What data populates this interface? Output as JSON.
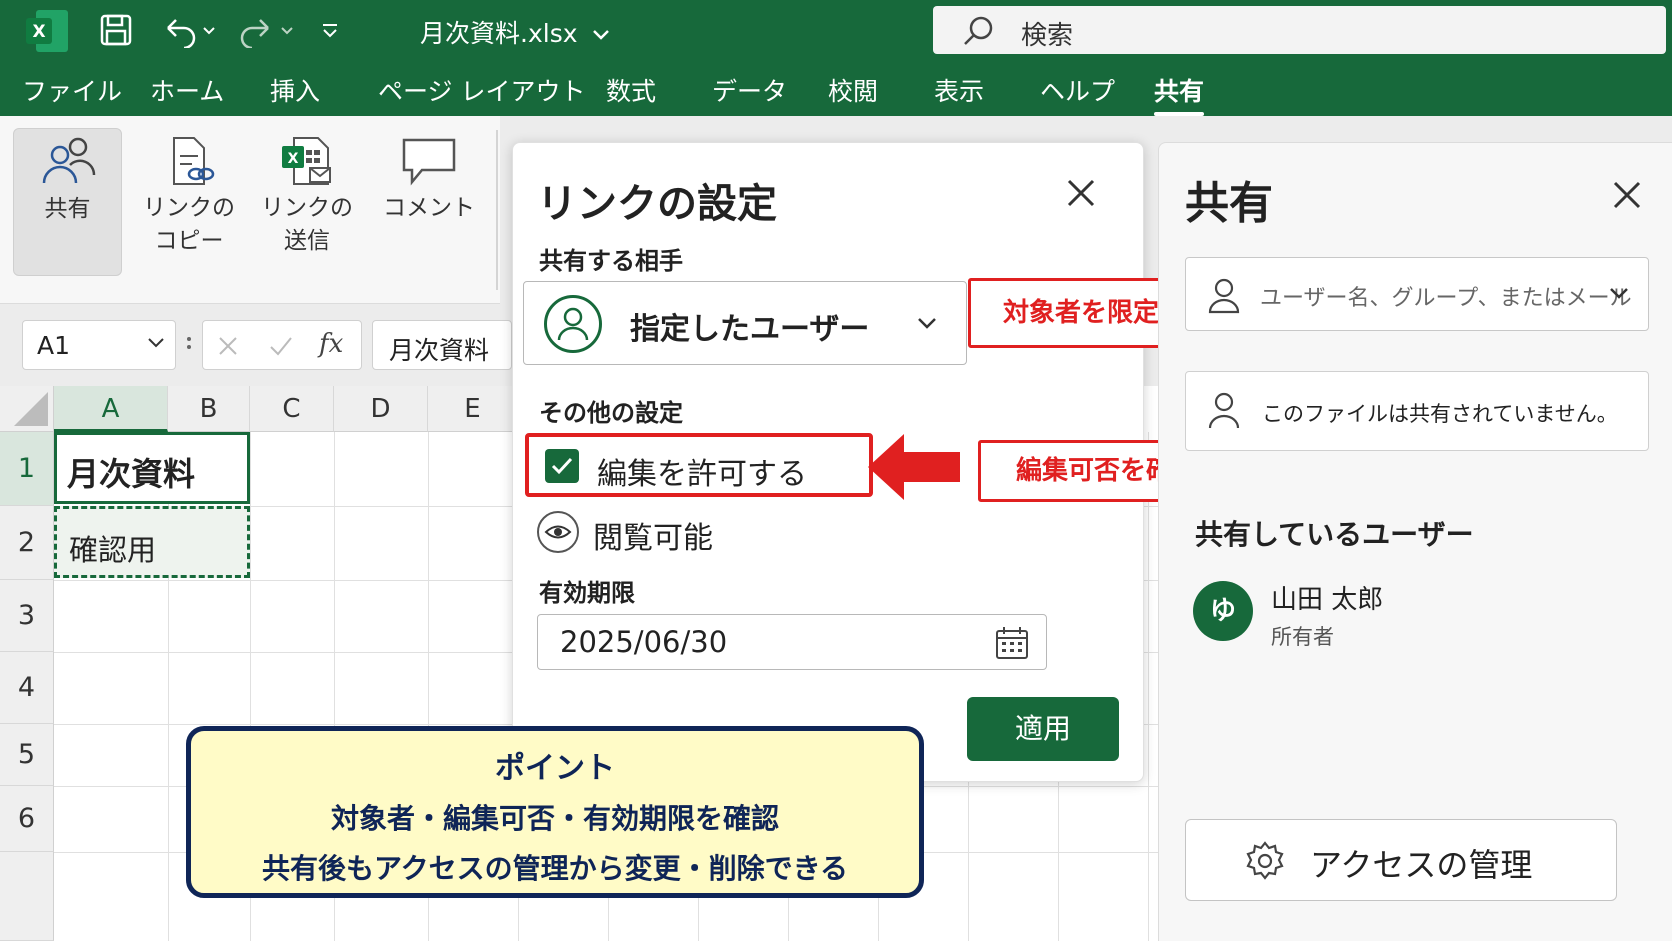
{
  "app": {
    "filename": "月次資料.xlsx",
    "search_placeholder": "検索"
  },
  "menu": [
    "ファイル",
    "ホーム",
    "挿入",
    "ページ レイアウト",
    "数式",
    "データ",
    "校閲",
    "表示",
    "ヘルプ",
    "共有"
  ],
  "menu_active": "共有",
  "ribbon": {
    "share": "共有",
    "copy_link_1": "リンクの",
    "copy_link_2": "コピー",
    "send_link_1": "リンクの",
    "send_link_2": "送信",
    "comment": "コメント"
  },
  "formula_bar": {
    "cell_ref": "A1",
    "formula_value": "月次資料"
  },
  "sheet": {
    "columns": [
      "A",
      "B",
      "C",
      "D",
      "E"
    ],
    "rows": [
      "1",
      "2",
      "3",
      "4",
      "5",
      "6"
    ],
    "a1": "月次資料",
    "a2": "確認用"
  },
  "link_dialog": {
    "title": "リンクの設定",
    "share_with_label": "共有する相手",
    "share_with_value": "指定したユーザー",
    "other_settings_label": "その他の設定",
    "allow_edit": "編集を許可する",
    "allow_edit_checked": true,
    "view_only": "閲覧可能",
    "expiry_label": "有効期限",
    "expiry_value": "2025/06/30",
    "apply": "適用"
  },
  "annotations": {
    "limit_audience": "対象者を限定",
    "check_edit": "編集可否を確認",
    "point_title": "ポイント",
    "point_line_1": "対象者・編集可否・有効期限を確認",
    "point_line_2": "共有後もアクセスの管理から変更・削除できる"
  },
  "share_pane": {
    "title": "共有",
    "input_placeholder": "ユーザー名、グループ、またはメール",
    "status": "このファイルは共有されていません。",
    "users_label": "共有しているユーザー",
    "user_initial": "ゆ",
    "user_name": "山田 太郎",
    "user_role": "所有者",
    "manage_access": "アクセスの管理"
  },
  "colors": {
    "excel_green": "#17693b",
    "annotation_red": "#e02020",
    "point_navy": "#0f2557",
    "point_bg": "#fffbc7"
  }
}
